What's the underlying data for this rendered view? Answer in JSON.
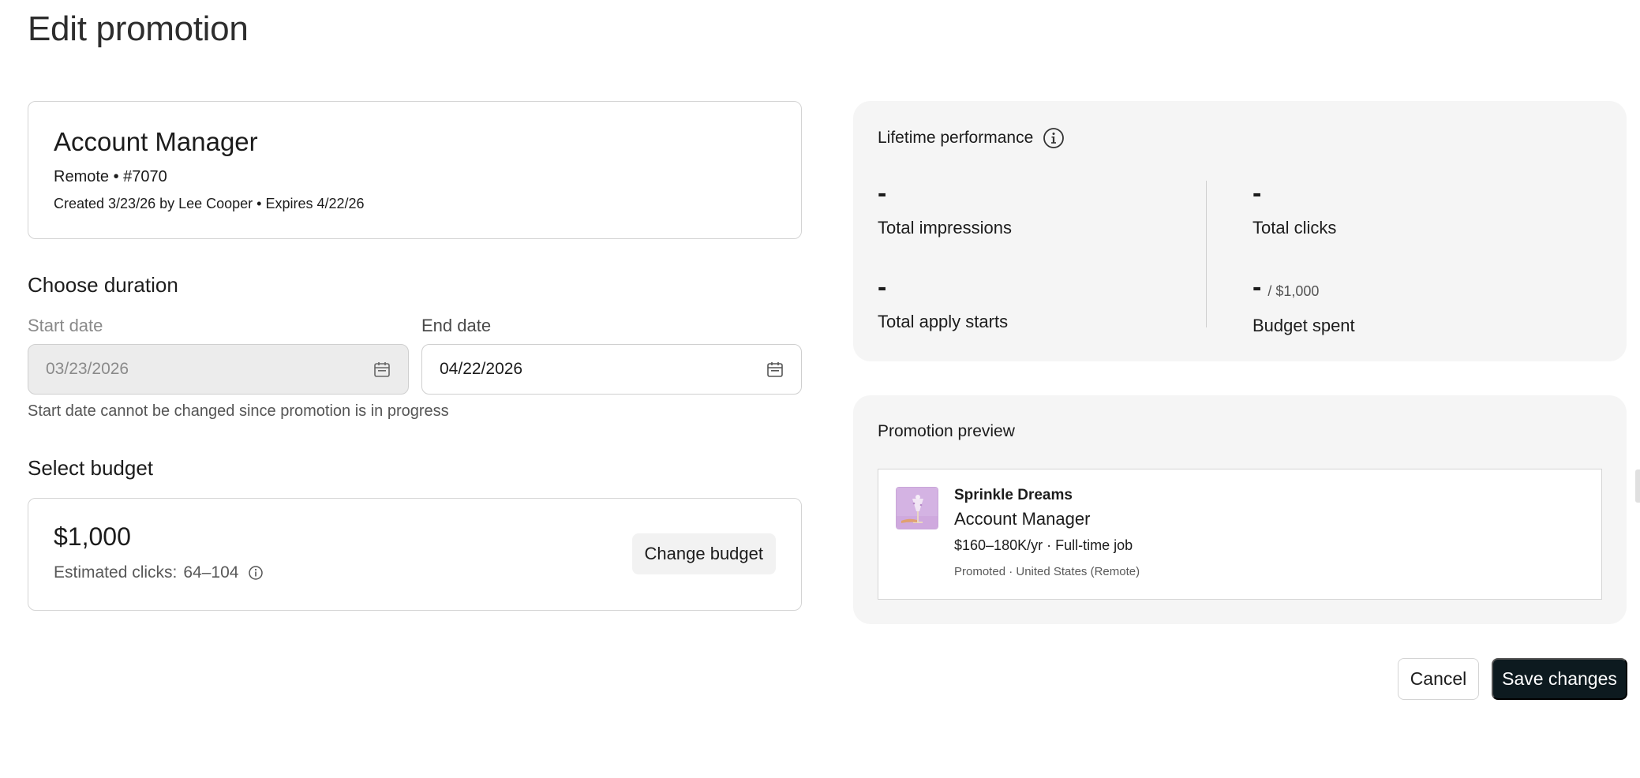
{
  "page": {
    "title": "Edit promotion"
  },
  "job": {
    "title": "Account Manager",
    "location_id": "Remote • #7070",
    "meta": "Created 3/23/26 by Lee Cooper • Expires 4/22/26"
  },
  "duration": {
    "heading": "Choose duration",
    "start_label": "Start date",
    "start_value": "03/23/2026",
    "end_label": "End date",
    "end_value": "04/22/2026",
    "helper": "Start date cannot be changed since promotion is in progress"
  },
  "budget": {
    "heading": "Select budget",
    "amount": "$1,000",
    "est_label": "Estimated clicks:",
    "est_value": "64–104",
    "change_label": "Change budget"
  },
  "performance": {
    "title": "Lifetime performance",
    "metrics": [
      {
        "value": "-",
        "label": "Total impressions"
      },
      {
        "value": "-",
        "label": "Total clicks"
      },
      {
        "value": "-",
        "label": "Total apply starts"
      },
      {
        "value": "-",
        "suffix": "/ $1,000",
        "label": "Budget spent"
      }
    ]
  },
  "preview": {
    "title": "Promotion preview",
    "company": "Sprinkle Dreams",
    "job_title": "Account Manager",
    "salary": "$160–180K/yr · Full-time job",
    "meta": "Promoted · United States (Remote)"
  },
  "actions": {
    "cancel": "Cancel",
    "save": "Save changes"
  },
  "icons": {
    "calendar": "calendar-icon",
    "info": "info-icon"
  }
}
